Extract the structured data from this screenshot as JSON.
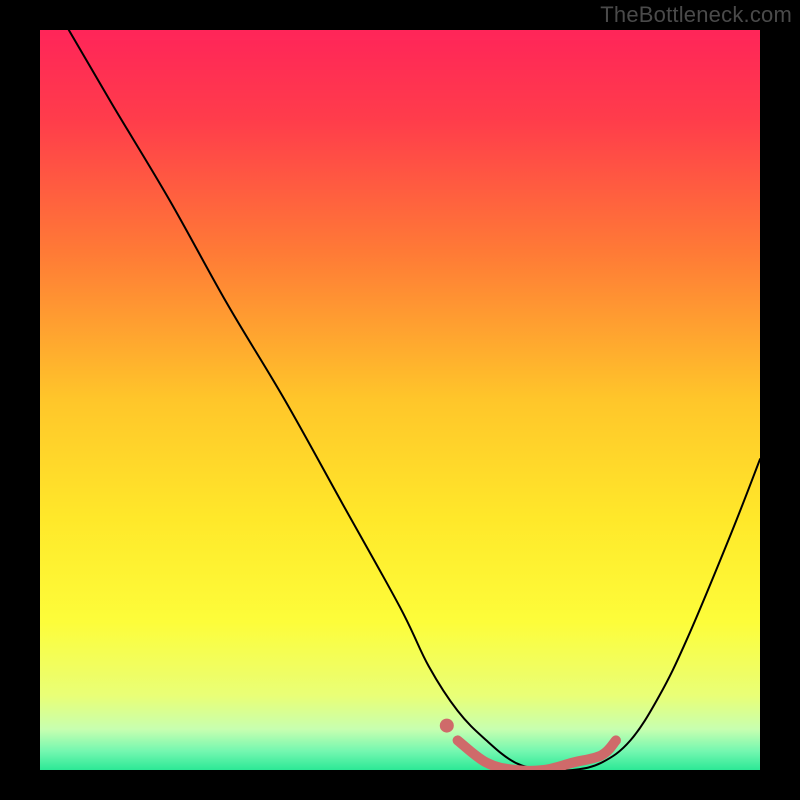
{
  "watermark": "TheBottleneck.com",
  "chart_data": {
    "type": "line",
    "title": "",
    "xlabel": "",
    "ylabel": "",
    "xlim": [
      0,
      100
    ],
    "ylim": [
      0,
      100
    ],
    "grid": false,
    "legend_position": "none",
    "series": [
      {
        "name": "bottleneck-curve",
        "x": [
          4,
          10,
          18,
          26,
          34,
          42,
          50,
          54,
          58,
          62,
          66,
          70,
          74,
          78,
          82,
          86,
          90,
          96,
          100
        ],
        "y": [
          100,
          90,
          77,
          63,
          50,
          36,
          22,
          14,
          8,
          4,
          1,
          0,
          0,
          1,
          4,
          10,
          18,
          32,
          42
        ],
        "color": "#000000",
        "stroke_width": 2
      },
      {
        "name": "optimal-range-highlight",
        "x": [
          58,
          62,
          66,
          70,
          74,
          78,
          80
        ],
        "y": [
          4,
          1,
          0,
          0,
          1,
          2,
          4
        ],
        "color": "#cf6a6a",
        "stroke_width": 10
      },
      {
        "name": "recommended-point",
        "type": "scatter",
        "x": [
          56.5
        ],
        "y": [
          6
        ],
        "color": "#cf6a6a",
        "marker_size": 7
      }
    ],
    "background_gradient": {
      "stops": [
        {
          "offset": 0.0,
          "color": "#ff2559"
        },
        {
          "offset": 0.12,
          "color": "#ff3c4b"
        },
        {
          "offset": 0.3,
          "color": "#ff7a36"
        },
        {
          "offset": 0.5,
          "color": "#ffc62a"
        },
        {
          "offset": 0.66,
          "color": "#ffe82a"
        },
        {
          "offset": 0.8,
          "color": "#fdfd3a"
        },
        {
          "offset": 0.9,
          "color": "#e9ff77"
        },
        {
          "offset": 0.945,
          "color": "#c7ffb0"
        },
        {
          "offset": 0.975,
          "color": "#73f7b0"
        },
        {
          "offset": 1.0,
          "color": "#2ce896"
        }
      ]
    }
  }
}
